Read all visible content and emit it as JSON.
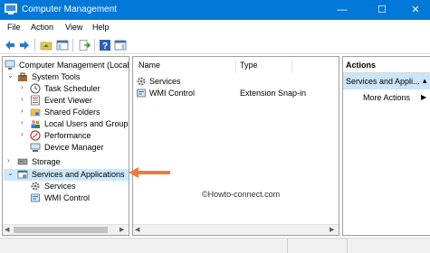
{
  "window": {
    "title": "Computer Management",
    "controls": {
      "minimize": "—",
      "maximize": "☐",
      "close": "✕"
    }
  },
  "menu": [
    "File",
    "Action",
    "View",
    "Help"
  ],
  "toolbar": {
    "buttons": [
      "back-icon",
      "forward-icon",
      "folder-up-icon",
      "show-hide-tree-icon",
      "export-list-icon",
      "help-icon",
      "show-hide-action-pane-icon"
    ]
  },
  "tree": {
    "root": "Computer Management (Local",
    "items": [
      {
        "label": "System Tools",
        "icon": "system-tools-icon"
      },
      {
        "label": "Task Scheduler",
        "icon": "clock-icon"
      },
      {
        "label": "Event Viewer",
        "icon": "event-viewer-icon"
      },
      {
        "label": "Shared Folders",
        "icon": "shared-folder-icon"
      },
      {
        "label": "Local Users and Groups",
        "icon": "users-icon"
      },
      {
        "label": "Performance",
        "icon": "performance-icon"
      },
      {
        "label": "Device Manager",
        "icon": "device-manager-icon"
      },
      {
        "label": "Storage",
        "icon": "storage-icon"
      },
      {
        "label": "Services and Applications",
        "icon": "services-apps-icon"
      },
      {
        "label": "Services",
        "icon": "gear-icon"
      },
      {
        "label": "WMI Control",
        "icon": "wmi-icon"
      }
    ],
    "selected": "Services and Applications"
  },
  "list": {
    "columns": [
      "Name",
      "Type"
    ],
    "rows": [
      {
        "name": "Services",
        "type": ""
      },
      {
        "name": "WMI Control",
        "type": "Extension Snap-in"
      }
    ]
  },
  "watermark": "©Howto-connect.com",
  "actions": {
    "header": "Actions",
    "section": "Services and Appli...",
    "items": [
      "More Actions"
    ]
  },
  "colors": {
    "titlebar": "#0078d7",
    "selection": "#cce8ff",
    "arrow": "#f07a3a"
  }
}
